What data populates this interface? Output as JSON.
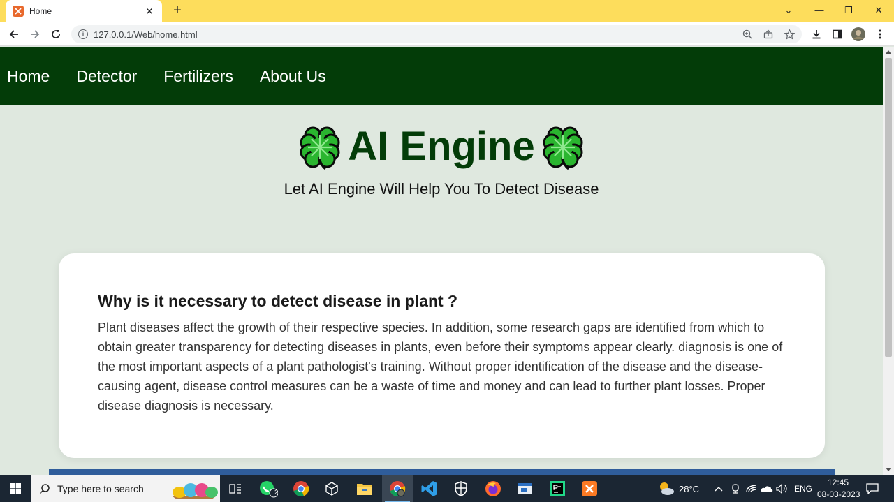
{
  "browser": {
    "tab_title": "Home",
    "tab_close": "✕",
    "new_tab": "+",
    "url": "127.0.0.1/Web/home.html",
    "window_controls": {
      "dropdown": "⌄",
      "minimize": "—",
      "restore": "❐",
      "close": "✕"
    }
  },
  "nav": {
    "items": [
      {
        "label": "Home"
      },
      {
        "label": "Detector"
      },
      {
        "label": "Fertilizers"
      },
      {
        "label": "About Us"
      }
    ]
  },
  "hero": {
    "title": "AI Engine",
    "subtitle": "Let AI Engine Will Help You To Detect Disease",
    "icon": "four-leaf-clover-icon"
  },
  "card": {
    "heading": "Why is it necessary to detect disease in plant ?",
    "text": "Plant diseases affect the growth of their respective species. In addition, some research gaps are identified from which to obtain greater transparency for detecting diseases in plants, even before their symptoms appear clearly. diagnosis is one of the most important aspects of a plant pathologist's training. Without proper identification of the disease and the disease-causing agent, disease control measures can be a waste of time and money and can lead to further plant losses. Proper disease diagnosis is necessary."
  },
  "taskbar": {
    "search_placeholder": "Type here to search",
    "whatsapp_badge": "2",
    "temperature": "28°C",
    "language": "ENG",
    "time": "12:45",
    "date": "08-03-2023"
  },
  "colors": {
    "nav_bg": "#033c08",
    "page_bg": "#dfe8df",
    "title": "#033c08",
    "clover": "#2ab52f",
    "tab_strip": "#fddd5c",
    "taskbar": "#1b2633"
  }
}
